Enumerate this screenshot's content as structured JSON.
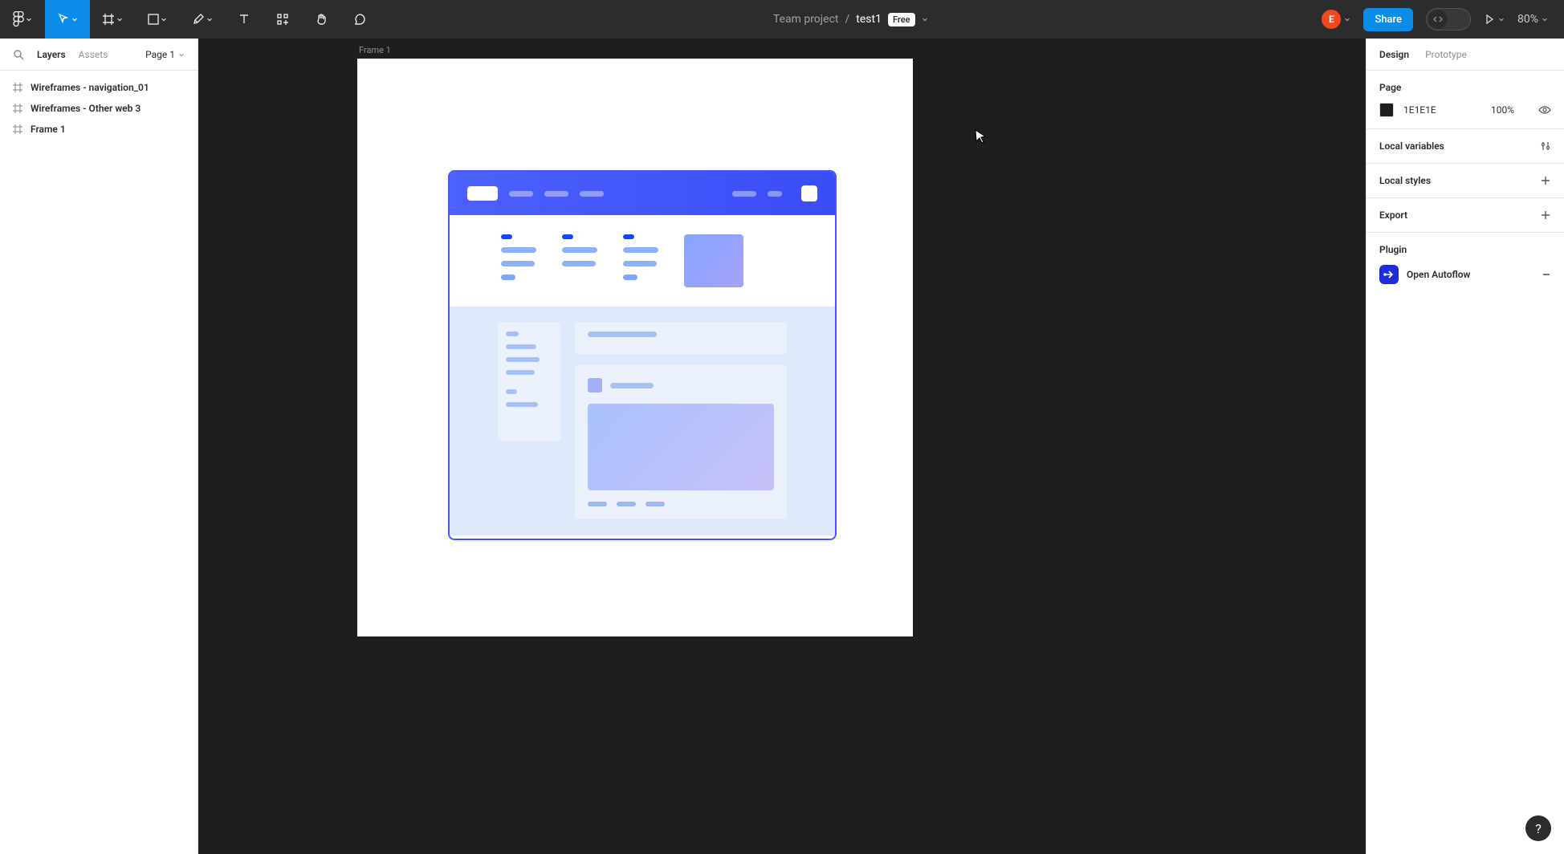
{
  "toolbar": {
    "project": "Team project",
    "file": "test1",
    "plan_badge": "Free",
    "share_label": "Share",
    "zoom": "80%",
    "avatar_initial": "E"
  },
  "left": {
    "tabs": {
      "layers": "Layers",
      "assets": "Assets"
    },
    "page_label": "Page 1",
    "layers": [
      "Wireframes - navigation_01",
      "Wireframes - Other web 3",
      "Frame 1"
    ]
  },
  "canvas": {
    "frame_label": "Frame 1"
  },
  "right": {
    "tabs": {
      "design": "Design",
      "prototype": "Prototype"
    },
    "page_section_title": "Page",
    "bg_hex": "1E1E1E",
    "bg_opacity": "100%",
    "local_variables": "Local variables",
    "local_styles": "Local styles",
    "export": "Export",
    "plugin_title": "Plugin",
    "plugin_name": "Open Autoflow"
  },
  "help": "?"
}
